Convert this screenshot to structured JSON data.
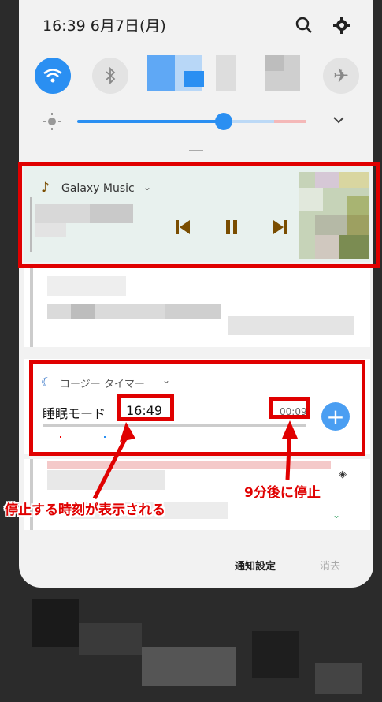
{
  "status": {
    "time_date": "16:39  6月7日(月)",
    "search_icon": "search-icon",
    "settings_icon": "gear-icon"
  },
  "quick_settings": {
    "wifi_color": "#2a8ff2"
  },
  "media": {
    "app_name": "Galaxy Music",
    "background": "#e8f1ee",
    "control_color": "#7a4d00"
  },
  "timer": {
    "app_name": "コージー タイマー",
    "label": "睡眠モード",
    "stop_time": "16:49",
    "remaining": "00:09"
  },
  "footer": {
    "settings": "通知設定",
    "clear": "消去"
  },
  "annotations": {
    "stop_time_note": "停止する時刻が表示される",
    "remaining_note": "9分後に停止"
  },
  "accent_red": "#e00000"
}
